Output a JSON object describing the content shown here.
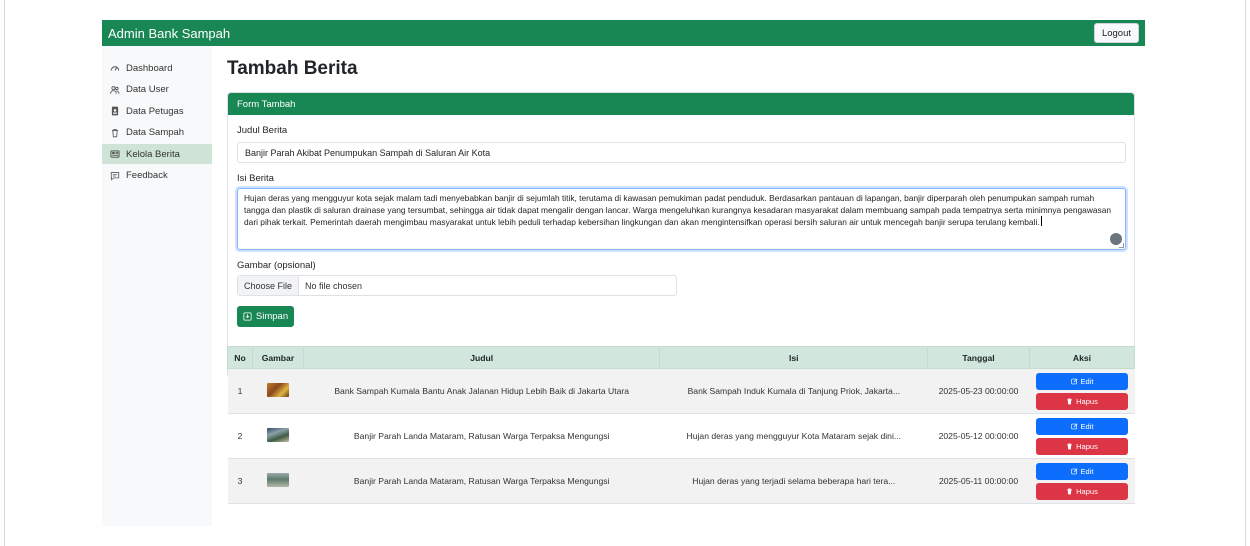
{
  "navbar": {
    "brand": "Admin Bank Sampah",
    "logout_label": "Logout"
  },
  "sidebar": {
    "items": [
      {
        "label": "Dashboard",
        "icon": "dashboard-icon"
      },
      {
        "label": "Data User",
        "icon": "users-icon"
      },
      {
        "label": "Data Petugas",
        "icon": "person-badge-icon"
      },
      {
        "label": "Data Sampah",
        "icon": "trash-icon"
      },
      {
        "label": "Kelola Berita",
        "icon": "newspaper-icon",
        "active": true
      },
      {
        "label": "Feedback",
        "icon": "chat-icon"
      }
    ]
  },
  "page": {
    "title": "Tambah Berita"
  },
  "form": {
    "header": "Form Tambah",
    "judul_label": "Judul Berita",
    "judul_value": "Banjir Parah Akibat Penumpukan Sampah di Saluran Air Kota",
    "isi_label": "Isi Berita",
    "isi_value": "Hujan deras yang mengguyur kota sejak malam tadi menyebabkan banjir di sejumlah titik, terutama di kawasan pemukiman padat penduduk. Berdasarkan pantauan di lapangan, banjir diperparah oleh penumpukan sampah rumah tangga dan plastik di saluran drainase yang tersumbat, sehingga air tidak dapat mengalir dengan lancar. Warga mengeluhkan kurangnya kesadaran masyarakat dalam membuang sampah pada tempatnya serta minimnya pengawasan dari pihak terkait. Pemerintah daerah mengimbau masyarakat untuk lebih peduli terhadap kebersihan lingkungan dan akan mengintensifkan operasi bersih saluran air untuk mencegah banjir serupa terulang kembali.",
    "gambar_label": "Gambar (opsional)",
    "file_button": "Choose File",
    "file_status": "No file chosen",
    "submit_label": "Simpan"
  },
  "table": {
    "headers": [
      "No",
      "Gambar",
      "Judul",
      "Isi",
      "Tanggal",
      "Aksi"
    ],
    "edit_label": "Edit",
    "delete_label": "Hapus",
    "rows": [
      {
        "no": "1",
        "judul": "Bank Sampah Kumala Bantu Anak Jalanan Hidup Lebih Baik di Jakarta Utara",
        "isi": "Bank Sampah Induk Kumala di Tanjung Priok, Jakarta...",
        "tanggal": "2025-05-23 00:00:00"
      },
      {
        "no": "2",
        "judul": "Banjir Parah Landa Mataram, Ratusan Warga Terpaksa Mengungsi",
        "isi": "Hujan deras yang mengguyur Kota Mataram sejak dini...",
        "tanggal": "2025-05-12 00:00:00"
      },
      {
        "no": "3",
        "judul": "Banjir Parah Landa Mataram, Ratusan Warga Terpaksa Mengungsi",
        "isi": "Hujan deras yang terjadi selama beberapa hari tera...",
        "tanggal": "2025-05-11 00:00:00"
      }
    ]
  },
  "colors": {
    "primary_green": "#198754",
    "edit_blue": "#0d6efd",
    "delete_red": "#dc3545",
    "header_green_light": "#d1e7dd"
  }
}
